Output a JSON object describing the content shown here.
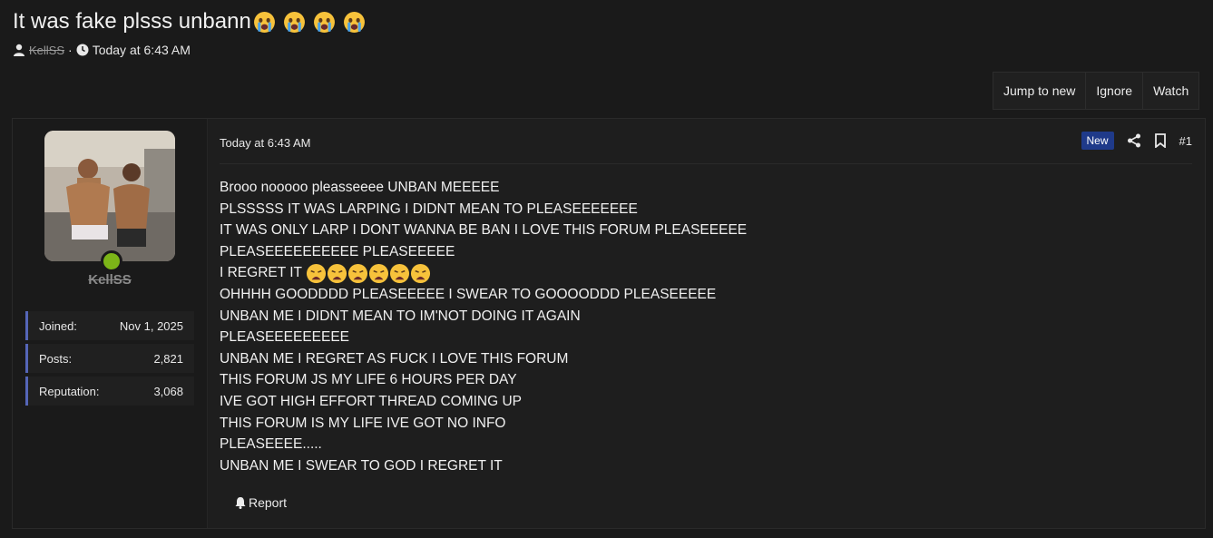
{
  "thread": {
    "title": "It was fake plsss unbann",
    "author": "KellSS",
    "date": "Today at 6:43 AM",
    "separator": "·"
  },
  "actions": {
    "jump_to_new": "Jump to new",
    "ignore": "Ignore",
    "watch": "Watch"
  },
  "user": {
    "name": "KellSS",
    "status_color": "#7cb518",
    "stats": [
      {
        "label": "Joined:",
        "value": "Nov 1, 2025"
      },
      {
        "label": "Posts:",
        "value": "2,821"
      },
      {
        "label": "Reputation:",
        "value": "3,068"
      }
    ]
  },
  "post": {
    "date": "Today at 6:43 AM",
    "badge": "New",
    "number": "#1",
    "lines": [
      "Brooo nooooo pleasseeee UNBAN MEEEEE",
      "PLSSSSS IT WAS LARPING I DIDNT MEAN TO PLEASEEEEEEE",
      "IT WAS ONLY LARP I DONT WANNA BE BAN I LOVE THIS FORUM PLEASEEEEE",
      "PLEASEEEEEEEEEE PLEASEEEEE",
      "I REGRET IT",
      "OHHHH GOODDDD PLEASEEEEE I SWEAR TO GOOOODDD PLEASEEEEE",
      "UNBAN ME I DIDNT MEAN TO IM'NOT DOING IT AGAIN",
      "PLEASEEEEEEEEE",
      "UNBAN ME I REGRET AS FUCK I LOVE THIS FORUM",
      "THIS FORUM JS MY LIFE 6 HOURS PER DAY",
      "IVE GOT HIGH EFFORT THREAD COMING UP",
      "THIS FORUM IS MY LIFE IVE GOT NO INFO",
      "PLEASEEEE.....",
      "UNBAN ME I SWEAR TO GOD I REGRET IT"
    ],
    "report": "Report"
  },
  "icons": {
    "title_emoji": "crying-face-icon",
    "regret_emoji": "weary-face-icon"
  },
  "colors": {
    "accent": "#5566b8",
    "badge": "#1f3a8a",
    "online": "#7cb518"
  }
}
